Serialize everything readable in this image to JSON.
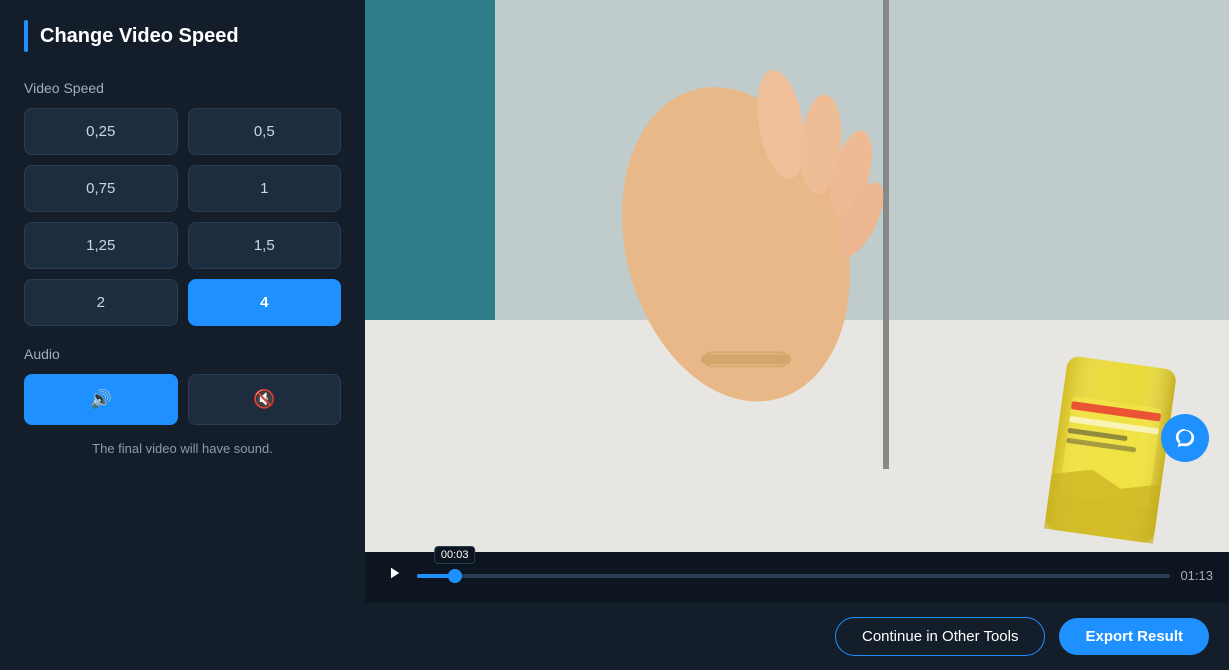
{
  "panel": {
    "title": "Change Video Speed",
    "title_bar_color": "#1e90ff"
  },
  "video_speed": {
    "label": "Video Speed",
    "options": [
      {
        "value": "0,25",
        "active": false
      },
      {
        "value": "0,5",
        "active": false
      },
      {
        "value": "0,75",
        "active": false
      },
      {
        "value": "1",
        "active": false
      },
      {
        "value": "1,25",
        "active": false
      },
      {
        "value": "1,5",
        "active": false
      },
      {
        "value": "2",
        "active": false
      },
      {
        "value": "4",
        "active": true
      }
    ]
  },
  "audio": {
    "label": "Audio",
    "sound_on_label": "🔊",
    "sound_off_label": "🔇",
    "note": "The final video will have sound."
  },
  "player": {
    "current_time": "00:03",
    "total_time": "01:13",
    "progress_pct": 5
  },
  "footer": {
    "continue_label": "Continue in Other Tools",
    "export_label": "Export Result"
  }
}
